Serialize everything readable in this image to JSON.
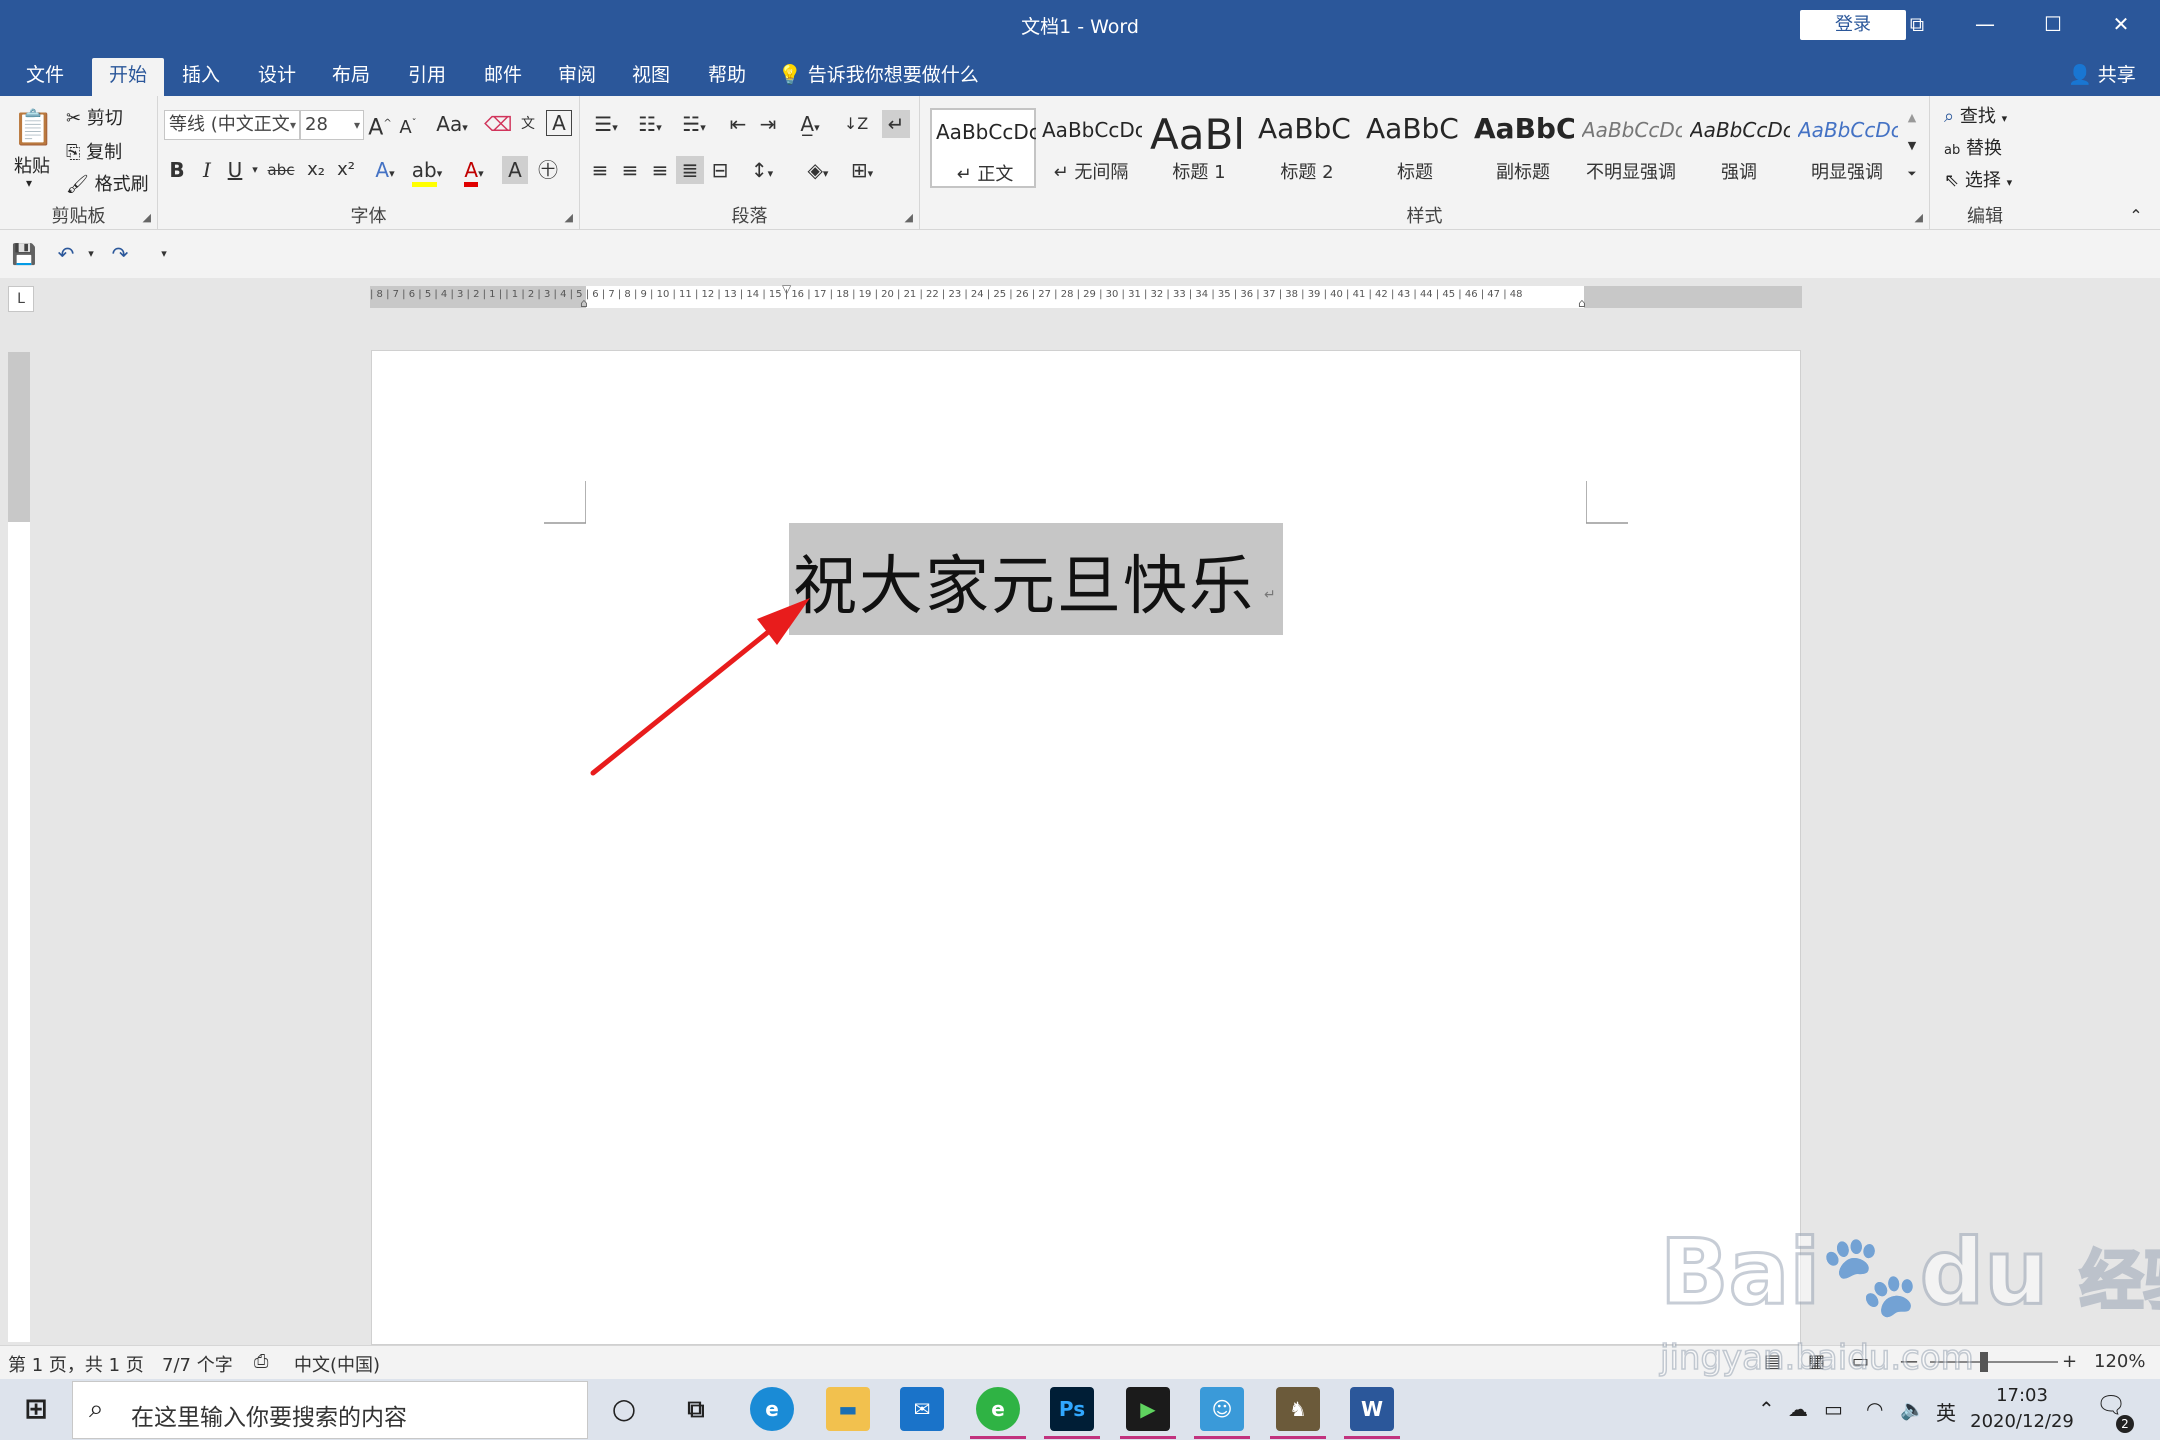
{
  "window": {
    "title": "文档1  -  Word",
    "login_label": "登录",
    "controls": [
      "⧉",
      "—",
      "☐",
      "✕"
    ]
  },
  "tabs": [
    {
      "label": "文件"
    },
    {
      "label": "开始"
    },
    {
      "label": "插入"
    },
    {
      "label": "设计"
    },
    {
      "label": "布局"
    },
    {
      "label": "引用"
    },
    {
      "label": "邮件"
    },
    {
      "label": "审阅"
    },
    {
      "label": "视图"
    },
    {
      "label": "帮助"
    }
  ],
  "active_tab": "开始",
  "tellme": "告诉我你想要做什么",
  "share": "共享",
  "ribbon": {
    "clipboard": {
      "paste": "粘贴",
      "cut": "剪切",
      "copy": "复制",
      "format_painter": "格式刷",
      "label": "剪贴板"
    },
    "font": {
      "font_name": "等线 (中文正文",
      "font_size": "28",
      "label": "字体",
      "grow": "A",
      "shrink": "A",
      "case": "Aa",
      "bold": "B",
      "italic": "I",
      "underline": "U",
      "strike": "abc",
      "subscript": "x₂",
      "superscript": "x²"
    },
    "paragraph": {
      "label": "段落"
    },
    "styles": {
      "label": "样式",
      "items": [
        {
          "sample": "AaBbCcDc",
          "name": "↵ 正文"
        },
        {
          "sample": "AaBbCcDc",
          "name": "↵ 无间隔"
        },
        {
          "sample": "AaBl",
          "name": "标题 1"
        },
        {
          "sample": "AaBbC",
          "name": "标题 2"
        },
        {
          "sample": "AaBbC",
          "name": "标题"
        },
        {
          "sample": "AaBbC",
          "name": "副标题"
        },
        {
          "sample": "AaBbCcDc",
          "name": "不明显强调"
        },
        {
          "sample": "AaBbCcDc",
          "name": "强调"
        },
        {
          "sample": "AaBbCcDc",
          "name": "明显强调"
        }
      ]
    },
    "editing": {
      "find": "查找",
      "replace": "替换",
      "select": "选择",
      "label": "编辑"
    }
  },
  "ruler": {
    "numbers": "| 8 | 7 | 6 | 5 | 4 | 3 | 2 | 1 |   | 1 | 2 | 3 | 4 | 5 | 6 | 7 | 8 | 9 | 10 | 11 | 12 | 13 | 14 | 15 | 16 | 17 | 18 | 19 | 20 | 21 | 22 | 23 | 24 | 25 | 26 | 27 | 28 | 29 | 30 | 31 | 32 | 33 | 34 | 35 | 36 | 37 | 38 | 39 | 40 | 41 | 42 | 43 | 44 | 45 | 46 | 47 | 48"
  },
  "document": {
    "text": "祝大家元旦快乐",
    "para_mark": "↵"
  },
  "status": {
    "page": "第 1 页，共 1 页",
    "words": "7/7 个字",
    "language": "中文(中国)",
    "zoom": "120%"
  },
  "taskbar": {
    "search_placeholder": "在这里输入你要搜索的内容",
    "ime": "英",
    "time": "17:03",
    "date": "2020/12/29",
    "notifications": "2"
  },
  "watermark": {
    "brand_text": "Bai",
    "brand_text2": "du",
    "brand_cn": "经验",
    "url": "jingyan.baidu.com"
  },
  "colors": {
    "word_blue": "#2b579a",
    "arrow_red": "#e81c1c",
    "selection": "#c6c6c6"
  }
}
